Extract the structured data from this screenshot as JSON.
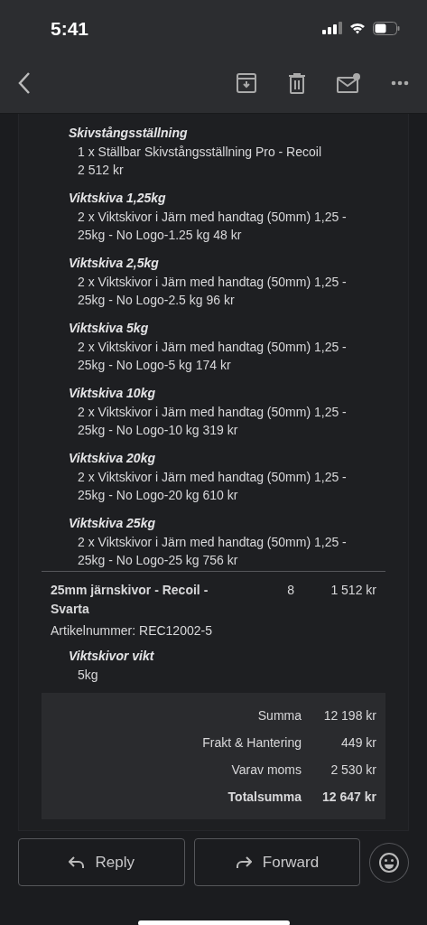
{
  "status_bar": {
    "time": "5:41"
  },
  "toolbar": {
    "actions": [
      {
        "kind": "archive"
      },
      {
        "kind": "delete"
      },
      {
        "kind": "unread"
      },
      {
        "kind": "more"
      }
    ]
  },
  "options": [
    {
      "title": "Skivstångsställning",
      "lines": [
        "1 x Ställbar Skivstångsställning Pro - Recoil",
        "2 512 kr"
      ]
    },
    {
      "title": "Viktskiva 1,25kg",
      "lines": [
        "2 x Viktskivor i Järn med handtag (50mm) 1,25 -",
        "25kg - No Logo-1.25 kg 48 kr"
      ]
    },
    {
      "title": "Viktskiva 2,5kg",
      "lines": [
        "2 x Viktskivor i Järn med handtag (50mm) 1,25 -",
        "25kg - No Logo-2.5 kg 96 kr"
      ]
    },
    {
      "title": "Viktskiva 5kg",
      "lines": [
        "2 x Viktskivor i Järn med handtag (50mm) 1,25 -",
        "25kg - No Logo-5 kg 174 kr"
      ]
    },
    {
      "title": "Viktskiva 10kg",
      "lines": [
        "2 x Viktskivor i Järn med handtag (50mm) 1,25 -",
        "25kg - No Logo-10 kg 319 kr"
      ]
    },
    {
      "title": "Viktskiva 20kg",
      "lines": [
        "2 x Viktskivor i Järn med handtag (50mm) 1,25 -",
        "25kg - No Logo-20 kg 610 kr"
      ]
    },
    {
      "title": "Viktskiva 25kg",
      "lines": [
        "2 x Viktskivor i Järn med handtag (50mm) 1,25 -",
        "25kg - No Logo-25 kg 756 kr"
      ]
    }
  ],
  "item": {
    "name": "25mm järnskivor - Recoil - Svarta",
    "quantity": "8",
    "price": "1 512 kr",
    "sku": "Artikelnummer: REC12002-5",
    "option": {
      "title": "Viktskivor vikt",
      "value": "5kg"
    }
  },
  "totals": [
    {
      "label": "Summa",
      "value": "12 198 kr",
      "bold": false
    },
    {
      "label": "Frakt & Hantering",
      "value": "449 kr",
      "bold": false
    },
    {
      "label": "Varav moms",
      "value": "2 530 kr",
      "bold": false
    },
    {
      "label": "Totalsumma",
      "value": "12 647 kr",
      "bold": true
    }
  ],
  "actions": [
    {
      "kind": "reply",
      "label": "Reply"
    },
    {
      "kind": "forward",
      "label": "Forward"
    }
  ]
}
